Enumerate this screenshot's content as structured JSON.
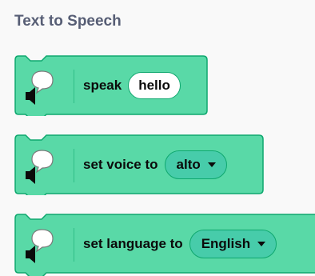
{
  "category": {
    "title": "Text to Speech"
  },
  "colors": {
    "block_fill": "#59d9a7",
    "block_stroke": "#0fa86f",
    "dropdown_fill": "#47ccaa",
    "title_text": "#575e75"
  },
  "blocks": [
    {
      "icon": "speaker-speech-bubble-icon",
      "label": "speak",
      "input": "hello"
    },
    {
      "icon": "speaker-speech-bubble-icon",
      "label": "set voice to",
      "dropdown": "alto"
    },
    {
      "icon": "speaker-speech-bubble-icon",
      "label": "set language to",
      "dropdown": "English"
    }
  ]
}
